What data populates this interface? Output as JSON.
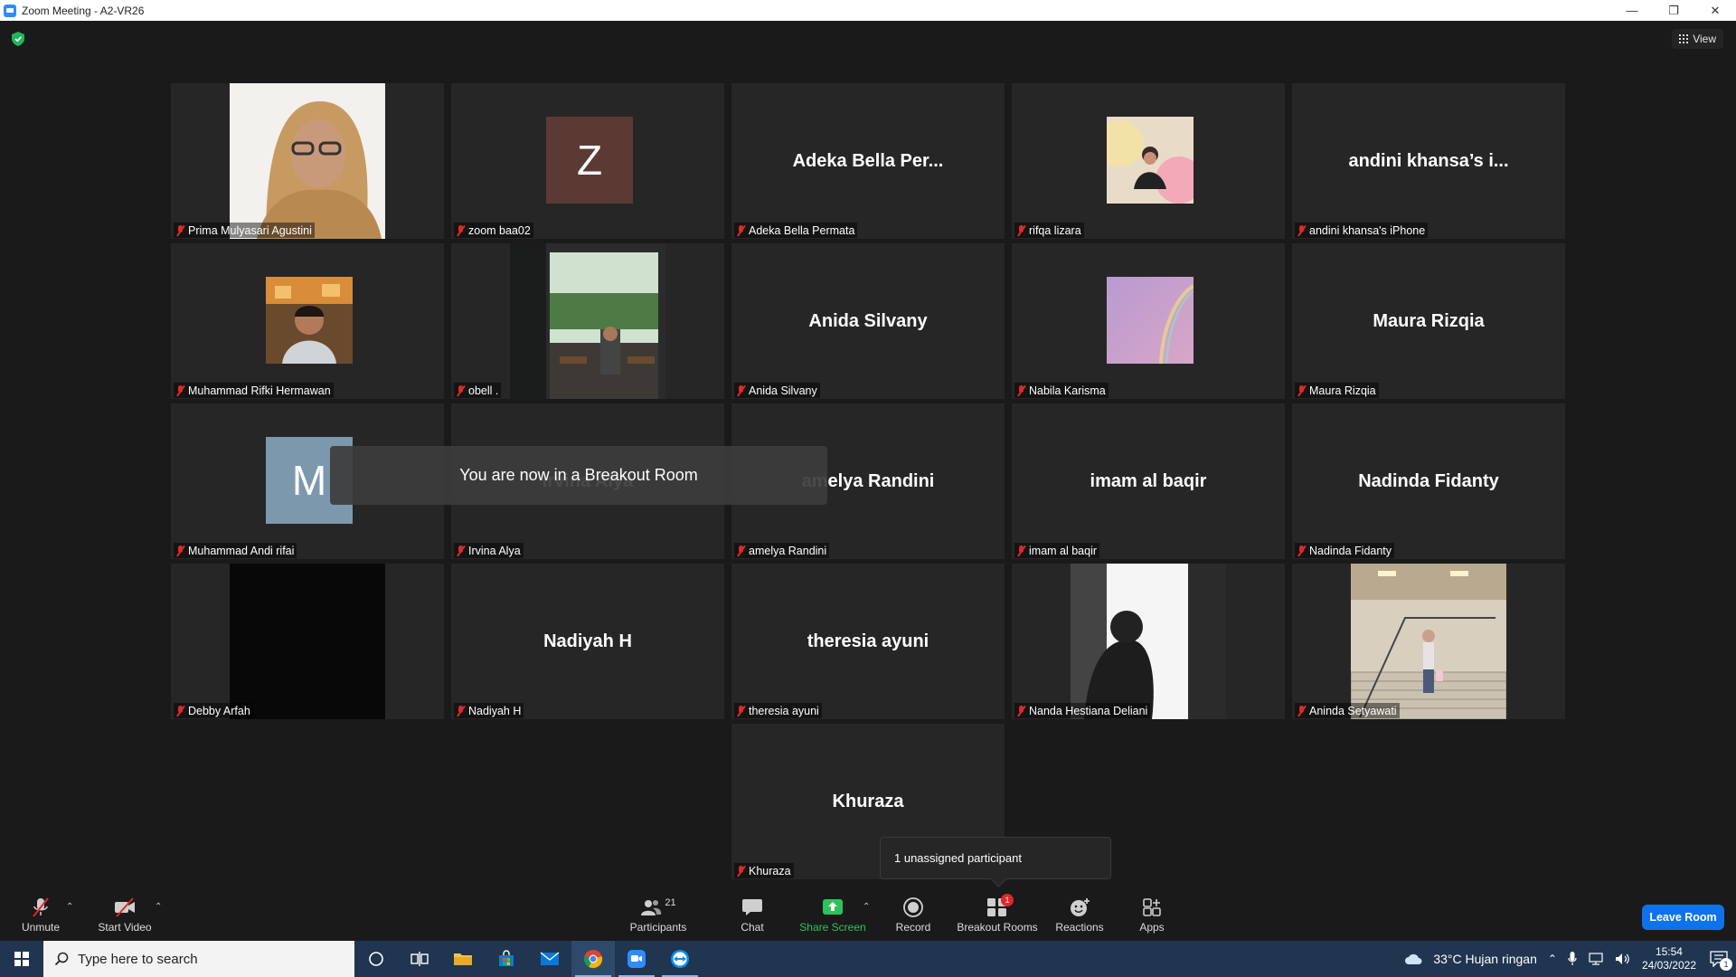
{
  "window": {
    "title": "Zoom Meeting - A2-VR26"
  },
  "view_button": {
    "label": "View"
  },
  "toast": {
    "text": "You are now in a Breakout Room"
  },
  "popover": {
    "text": "1 unassigned participant"
  },
  "tiles": [
    {
      "name": "Prima Mulyasari Agustini",
      "kind": "photo",
      "photo": "hijab-woman"
    },
    {
      "name": "zoom baa02",
      "kind": "letter",
      "letter": "Z",
      "color": "#5b3a33"
    },
    {
      "name": "Adeka Bella Permata",
      "kind": "text",
      "display": "Adeka Bella Per..."
    },
    {
      "name": "rifqa lizara",
      "kind": "photo",
      "photo": "balloons"
    },
    {
      "name": "andini khansa's iPhone",
      "kind": "text",
      "display": "andini khansa’s i..."
    },
    {
      "name": "Muhammad Rifki Hermawan",
      "kind": "photo",
      "photo": "man-cafe"
    },
    {
      "name": "obell .",
      "kind": "photo",
      "photo": "cafe-storefront"
    },
    {
      "name": "Anida Silvany",
      "kind": "text",
      "display": "Anida Silvany"
    },
    {
      "name": "Nabila Karisma",
      "kind": "photo",
      "photo": "rainbow-sky"
    },
    {
      "name": "Maura Rizqia",
      "kind": "text",
      "display": "Maura Rizqia"
    },
    {
      "name": "Muhammad Andi rifai",
      "kind": "letter",
      "letter": "M",
      "color": "#7c98ad"
    },
    {
      "name": "Irvina Alya",
      "kind": "text",
      "display": "Irvina Alya"
    },
    {
      "name": "amelya Randini",
      "kind": "text",
      "display": "amelya Randini"
    },
    {
      "name": "imam al baqir",
      "kind": "text",
      "display": "imam al baqir"
    },
    {
      "name": "Nadinda Fidanty",
      "kind": "text",
      "display": "Nadinda Fidanty"
    },
    {
      "name": "Debby Arfah",
      "kind": "photo",
      "photo": "dark-video"
    },
    {
      "name": "Nadiyah H",
      "kind": "text",
      "display": "Nadiyah H"
    },
    {
      "name": "theresia ayuni",
      "kind": "text",
      "display": "theresia ayuni"
    },
    {
      "name": "Nanda Hestiana Deliani",
      "kind": "photo",
      "photo": "window-silhouette"
    },
    {
      "name": "Aninda Setyawati",
      "kind": "photo",
      "photo": "stairs"
    },
    {
      "name": "Khuraza",
      "kind": "text",
      "display": "Khuraza"
    }
  ],
  "toolbar": {
    "unmute": "Unmute",
    "start_video": "Start Video",
    "participants": "Participants",
    "participants_count": "21",
    "chat": "Chat",
    "share_screen": "Share Screen",
    "record": "Record",
    "breakout_rooms": "Breakout Rooms",
    "breakout_badge": "1",
    "reactions": "Reactions",
    "apps": "Apps",
    "leave": "Leave Room"
  },
  "taskbar": {
    "search_placeholder": "Type here to search",
    "weather": "33°C  Hujan ringan",
    "time": "15:54",
    "date": "24/03/2022",
    "notifications": "1"
  },
  "colors": {
    "accent": "#0e72ed",
    "muted_red": "#e02828",
    "share_green": "#2ec25c",
    "tile_bg": "#262626"
  }
}
